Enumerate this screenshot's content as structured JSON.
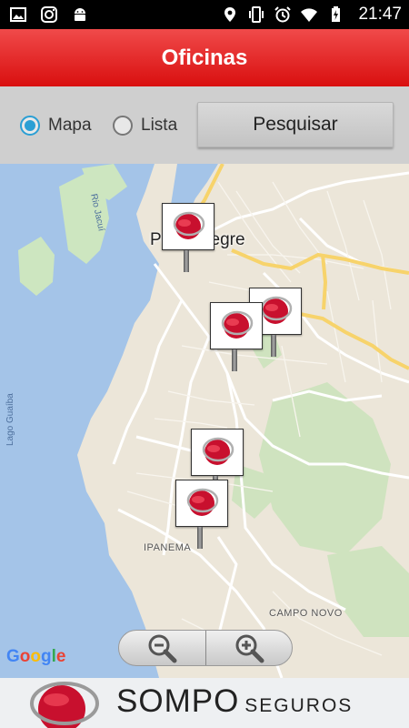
{
  "status_bar": {
    "time": "21:47",
    "left_icons": [
      "image-icon",
      "instagram-icon",
      "android-icon"
    ],
    "right_icons": [
      "location-icon",
      "vibrate-icon",
      "alarm-icon",
      "wifi-icon",
      "battery-charging-icon"
    ]
  },
  "header": {
    "title": "Oficinas",
    "color": "#e51a1a"
  },
  "controls": {
    "options": [
      {
        "label": "Mapa",
        "checked": true
      },
      {
        "label": "Lista",
        "checked": false
      }
    ],
    "search_label": "Pesquisar",
    "accent": "#2b9fd4"
  },
  "map": {
    "city_label": "Porto Alegre",
    "labels": {
      "rio_jacui": "Rio Jacuí",
      "lago_guaiba": "Lago Guaíba",
      "ipanema": "IPANEMA",
      "campo_novo": "CAMPO NOVO"
    },
    "marker_count": 5,
    "zoom_out_icon": "zoom-out-icon",
    "zoom_in_icon": "zoom-in-icon",
    "google_logo": "Google",
    "google_colors": [
      "#4285f4",
      "#ea4335",
      "#fbbc05",
      "#4285f4",
      "#34a853",
      "#ea4335"
    ]
  },
  "banner": {
    "brand": "SOMPO",
    "sub": "SEGUROS",
    "logo_color": "#c8102e"
  }
}
